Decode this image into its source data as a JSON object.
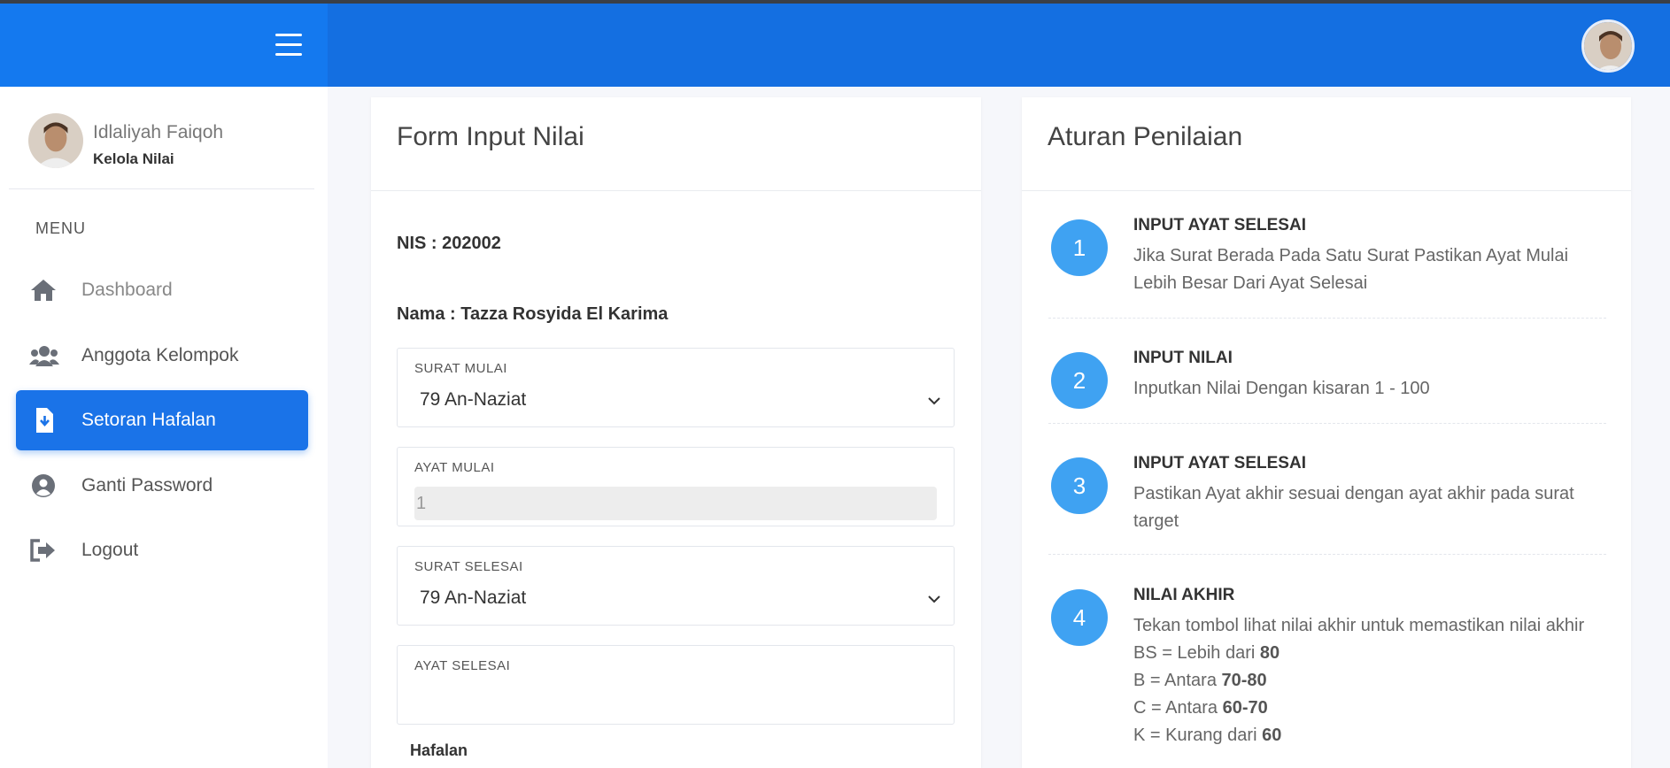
{
  "header": {
    "menu_icon": "hamburger-icon",
    "avatar_icon": "user-avatar"
  },
  "sidebar": {
    "user_name": "Idlaliyah Faiqoh",
    "user_role": "Kelola Nilai",
    "menu_label": "MENU",
    "items": [
      {
        "label": "Dashboard",
        "icon": "home-icon"
      },
      {
        "label": "Anggota Kelompok",
        "icon": "users-icon"
      },
      {
        "label": "Setoran Hafalan",
        "icon": "file-download-icon",
        "active": true
      },
      {
        "label": "Ganti Password",
        "icon": "user-circle-icon"
      },
      {
        "label": "Logout",
        "icon": "sign-out-icon"
      }
    ]
  },
  "form": {
    "title": "Form Input Nilai",
    "nis": "NIS : 202002",
    "nama": "Nama : Tazza Rosyida El Karima",
    "surat_mulai_label": "SURAT MULAI",
    "surat_mulai_value": "79 An-Naziat",
    "ayat_mulai_label": "AYAT MULAI",
    "ayat_mulai_value": "1",
    "surat_selesai_label": "SURAT SELESAI",
    "surat_selesai_value": "79 An-Naziat",
    "ayat_selesai_label": "AYAT SELESAI",
    "ayat_selesai_value": "",
    "hafalan_label": "Hafalan"
  },
  "rules": {
    "title": "Aturan Penilaian",
    "items": [
      {
        "num": "1",
        "title": "INPUT AYAT SELESAI",
        "desc": "Jika Surat Berada Pada Satu Surat Pastikan Ayat Mulai Lebih Besar Dari Ayat Selesai"
      },
      {
        "num": "2",
        "title": "INPUT NILAI",
        "desc": "Inputkan Nilai Dengan kisaran 1 - 100"
      },
      {
        "num": "3",
        "title": "INPUT AYAT SELESAI",
        "desc": "Pastikan Ayat akhir sesuai dengan ayat akhir pada surat target"
      },
      {
        "num": "4",
        "title": "NILAI AKHIR",
        "desc": "Tekan tombol lihat nilai akhir untuk memastikan nilai akhir",
        "grades": [
          {
            "text": "BS = Lebih dari ",
            "value": "80"
          },
          {
            "text": "B = Antara ",
            "value": "70-80"
          },
          {
            "text": "C = Antara ",
            "value": "60-70"
          },
          {
            "text": "K = Kurang dari ",
            "value": "60"
          }
        ]
      }
    ]
  },
  "colors": {
    "primary": "#146fe1",
    "accent": "#1a73e8",
    "badge": "#3fa2f2"
  }
}
